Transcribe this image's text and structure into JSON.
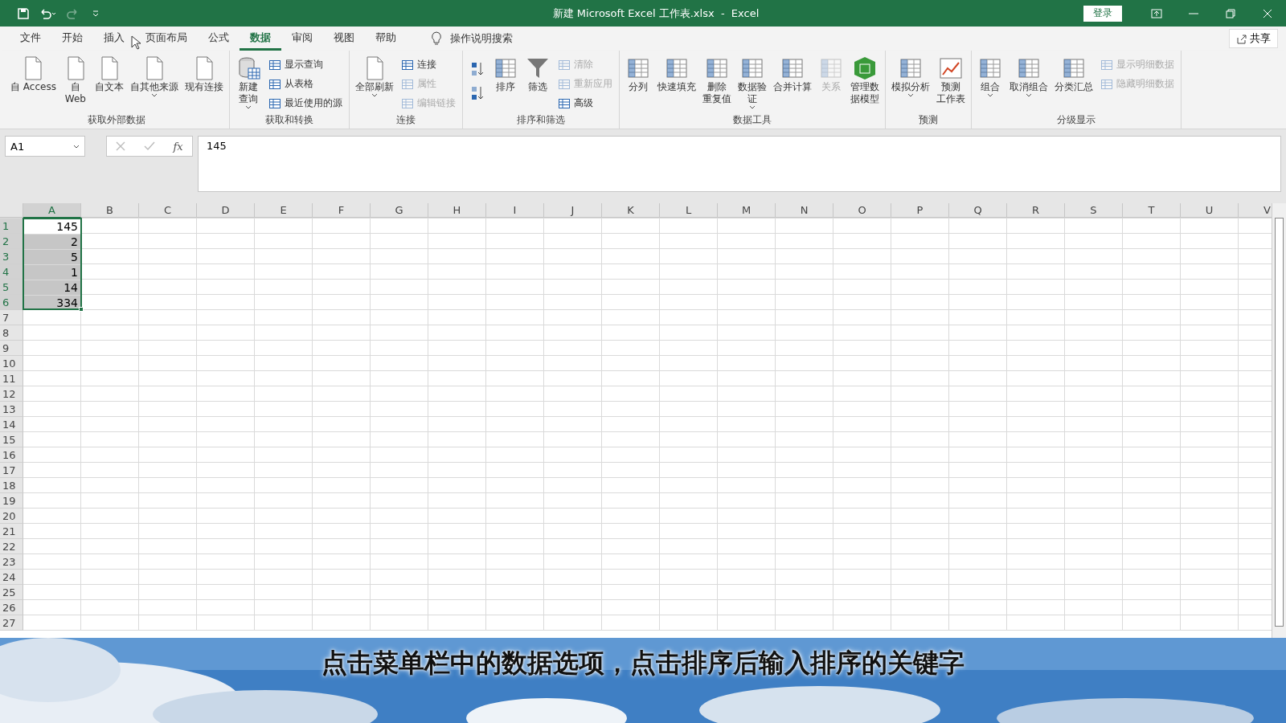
{
  "window": {
    "title": "新建 Microsoft Excel 工作表.xlsx  -  Excel",
    "sign_in": "登录"
  },
  "menu_tabs": [
    {
      "label": "文件",
      "selected": false
    },
    {
      "label": "开始",
      "selected": false
    },
    {
      "label": "插入",
      "selected": false
    },
    {
      "label": "页面布局",
      "selected": false
    },
    {
      "label": "公式",
      "selected": false
    },
    {
      "label": "数据",
      "selected": true
    },
    {
      "label": "审阅",
      "selected": false
    },
    {
      "label": "视图",
      "selected": false
    },
    {
      "label": "帮助",
      "selected": false
    }
  ],
  "tell_me": "操作说明搜索",
  "share": "共享",
  "ribbon_groups": [
    {
      "label": "获取外部数据",
      "items": [
        {
          "kind": "large",
          "label": "自 Access",
          "disabled": false,
          "dropdown": false
        },
        {
          "kind": "large",
          "lines": [
            "自",
            "Web"
          ],
          "disabled": false,
          "dropdown": false
        },
        {
          "kind": "large",
          "label": "自文本",
          "disabled": false,
          "dropdown": false
        },
        {
          "kind": "large",
          "label": "自其他来源",
          "disabled": false,
          "dropdown": true
        },
        {
          "kind": "large",
          "label": "现有连接",
          "disabled": false,
          "dropdown": false
        }
      ]
    },
    {
      "label": "获取和转换",
      "items": [
        {
          "kind": "large",
          "lines": [
            "新建",
            "查询"
          ],
          "disabled": false,
          "dropdown": true
        },
        {
          "kind": "stack",
          "items": [
            {
              "label": "显示查询",
              "disabled": false
            },
            {
              "label": "从表格",
              "disabled": false
            },
            {
              "label": "最近使用的源",
              "disabled": false
            }
          ]
        }
      ]
    },
    {
      "label": "连接",
      "items": [
        {
          "kind": "large",
          "label": "全部刷新",
          "disabled": false,
          "dropdown": true
        },
        {
          "kind": "stack",
          "items": [
            {
              "label": "连接",
              "disabled": false
            },
            {
              "label": "属性",
              "disabled": true
            },
            {
              "label": "编辑链接",
              "disabled": true
            }
          ]
        }
      ]
    },
    {
      "label": "排序和筛选",
      "items": [
        {
          "kind": "sort"
        },
        {
          "kind": "large",
          "label": "排序",
          "disabled": false,
          "dropdown": false
        },
        {
          "kind": "large",
          "label": "筛选",
          "disabled": false,
          "dropdown": false
        },
        {
          "kind": "stack",
          "items": [
            {
              "label": "清除",
              "disabled": true
            },
            {
              "label": "重新应用",
              "disabled": true
            },
            {
              "label": "高级",
              "disabled": false
            }
          ]
        }
      ]
    },
    {
      "label": "数据工具",
      "items": [
        {
          "kind": "large",
          "label": "分列",
          "disabled": false,
          "dropdown": false
        },
        {
          "kind": "large",
          "label": "快速填充",
          "disabled": false,
          "dropdown": false
        },
        {
          "kind": "large",
          "lines": [
            "删除",
            "重复值"
          ],
          "disabled": false,
          "dropdown": false
        },
        {
          "kind": "large",
          "lines": [
            "数据验",
            "证"
          ],
          "disabled": false,
          "dropdown": true
        },
        {
          "kind": "large",
          "label": "合并计算",
          "disabled": false,
          "dropdown": false
        },
        {
          "kind": "large",
          "label": "关系",
          "disabled": true,
          "dropdown": false
        },
        {
          "kind": "large",
          "lines": [
            "管理数",
            "据模型"
          ],
          "disabled": false,
          "dropdown": false
        }
      ]
    },
    {
      "label": "预测",
      "items": [
        {
          "kind": "large",
          "label": "模拟分析",
          "disabled": false,
          "dropdown": true
        },
        {
          "kind": "large",
          "lines": [
            "预测",
            "工作表"
          ],
          "disabled": false,
          "dropdown": false
        }
      ]
    },
    {
      "label": "分级显示",
      "items": [
        {
          "kind": "large",
          "label": "组合",
          "disabled": false,
          "dropdown": true
        },
        {
          "kind": "large",
          "label": "取消组合",
          "disabled": false,
          "dropdown": true
        },
        {
          "kind": "large",
          "label": "分类汇总",
          "disabled": false,
          "dropdown": false
        },
        {
          "kind": "stack",
          "items": [
            {
              "label": "显示明细数据",
              "disabled": true
            },
            {
              "label": "隐藏明细数据",
              "disabled": true
            }
          ]
        }
      ]
    }
  ],
  "formula_bar": {
    "name_box": "A1",
    "function_label": "fx",
    "value": "145"
  },
  "sheet": {
    "columns": [
      "A",
      "B",
      "C",
      "D",
      "E",
      "F",
      "G",
      "H",
      "I",
      "J",
      "K",
      "L",
      "M",
      "N",
      "O",
      "P",
      "Q",
      "R",
      "S",
      "T",
      "U",
      "V"
    ],
    "rows": [
      {
        "header": "1",
        "cells": [
          {
            "value": "145",
            "selected": true
          }
        ]
      },
      {
        "header": "2",
        "cells": [
          {
            "value": "2",
            "selected": true
          }
        ]
      },
      {
        "header": "3",
        "cells": [
          {
            "value": "5",
            "selected": true
          }
        ]
      },
      {
        "header": "4",
        "cells": [
          {
            "value": "1",
            "selected": true
          }
        ]
      },
      {
        "header": "5",
        "cells": [
          {
            "value": "14",
            "selected": true
          }
        ]
      },
      {
        "header": "6",
        "cells": [
          {
            "value": "334",
            "selected": true
          }
        ]
      },
      {
        "header": "7",
        "cells": []
      },
      {
        "header": "8",
        "cells": []
      },
      {
        "header": "9",
        "cells": []
      },
      {
        "header": "10",
        "cells": []
      },
      {
        "header": "11",
        "cells": []
      },
      {
        "header": "12",
        "cells": []
      },
      {
        "header": "13",
        "cells": []
      },
      {
        "header": "14",
        "cells": []
      },
      {
        "header": "15",
        "cells": []
      },
      {
        "header": "16",
        "cells": []
      },
      {
        "header": "17",
        "cells": []
      },
      {
        "header": "18",
        "cells": []
      },
      {
        "header": "19",
        "cells": []
      },
      {
        "header": "20",
        "cells": []
      },
      {
        "header": "21",
        "cells": []
      },
      {
        "header": "22",
        "cells": []
      },
      {
        "header": "23",
        "cells": []
      },
      {
        "header": "24",
        "cells": []
      },
      {
        "header": "25",
        "cells": []
      },
      {
        "header": "26",
        "cells": []
      },
      {
        "header": "27",
        "cells": []
      }
    ]
  },
  "caption": "点击菜单栏中的数据选项，点击排序后输入排序的关键字"
}
